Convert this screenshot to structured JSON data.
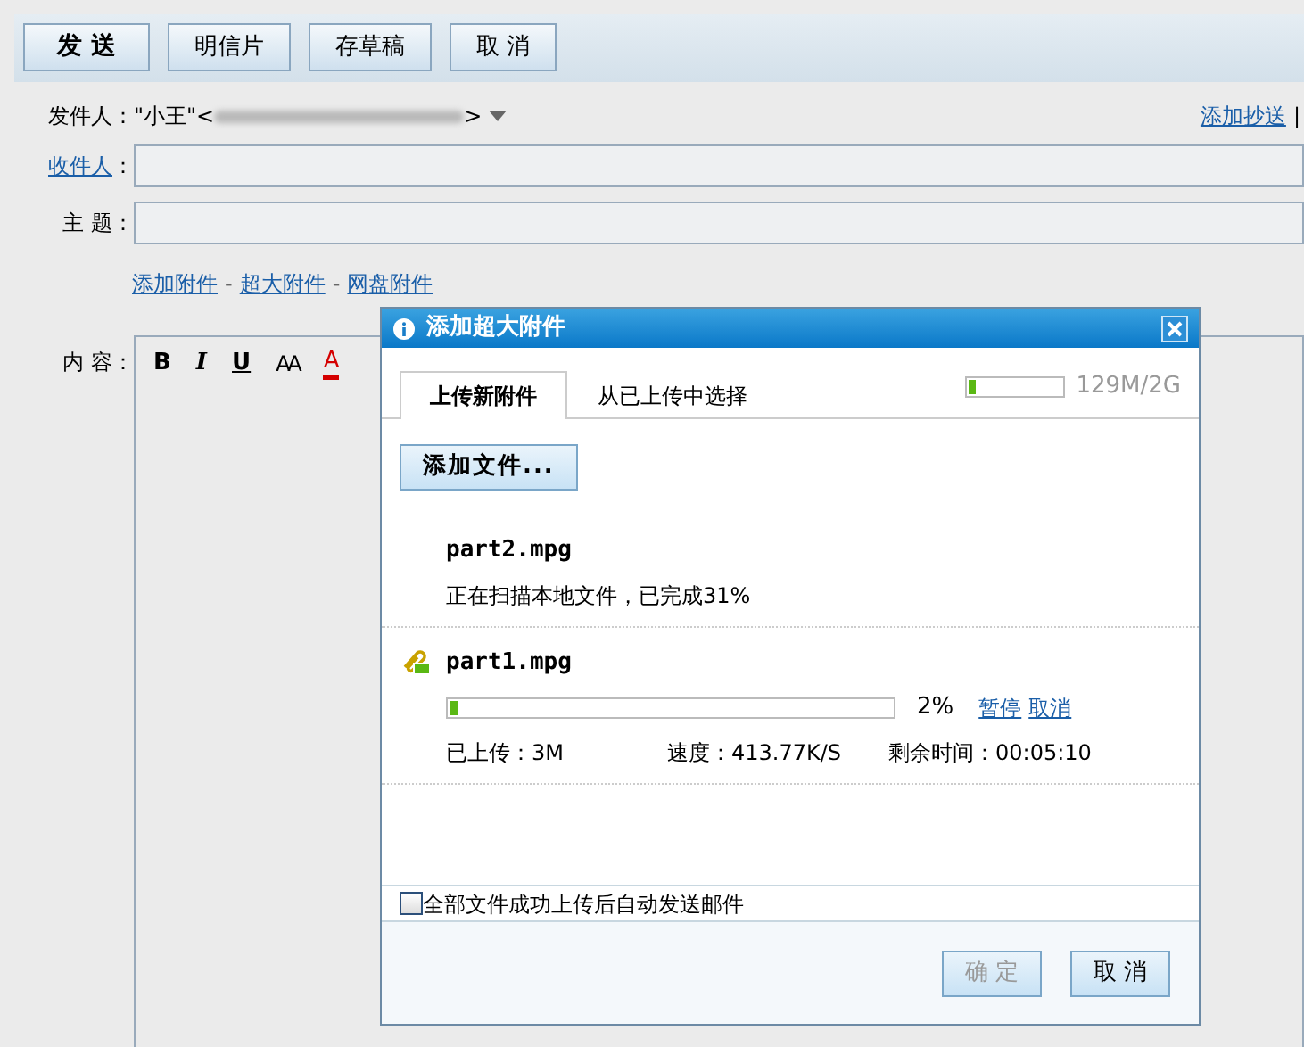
{
  "toolbar": {
    "buttons": [
      {
        "label": "发 送",
        "kind": "primary"
      },
      {
        "label": "明信片",
        "kind": "normal"
      },
      {
        "label": "存草稿",
        "kind": "normal"
      },
      {
        "label": "取 消",
        "kind": "normal"
      }
    ]
  },
  "sender": {
    "label": "发件人：",
    "value_start": "\"小王\"<",
    "value_end": ">"
  },
  "add_cc": "添加抄送",
  "right_separator": "|",
  "recipient": {
    "link": "收件人",
    "colon": "："
  },
  "subject": {
    "label": "主 题："
  },
  "attach_links": [
    {
      "label": "添加附件"
    },
    {
      "label": "超大附件"
    },
    {
      "label": "网盘附件"
    }
  ],
  "attach_separator": "-",
  "content": {
    "label": "内 容："
  },
  "editor_tools": [
    {
      "kind": "bold",
      "label": "B"
    },
    {
      "kind": "italic",
      "label": "I"
    },
    {
      "kind": "underline",
      "label": "U"
    },
    {
      "kind": "size",
      "label": "AA"
    },
    {
      "kind": "color",
      "label": "A",
      "color": "#d40000"
    }
  ],
  "dialog": {
    "title": "添加超大附件",
    "tabs": [
      {
        "label": "上传新附件",
        "selected": true
      },
      {
        "label": "从已上传中选择",
        "selected": false
      }
    ],
    "quota": {
      "level": 0.06,
      "reading": "129M/2G"
    },
    "add_button": "添加文件...",
    "files": [
      {
        "kind": "scanning",
        "name": "part2.mpg",
        "status": "正在扫描本地文件，已完成31%"
      },
      {
        "kind": "uploading",
        "name": "part1.mpg",
        "level": 0.02,
        "percent": "2%",
        "actions": [
          "暂停",
          "取消"
        ],
        "uploaded": "已上传：3M",
        "speed": "速度：413.77K/S",
        "remaining": "剩余时间：00:05:10"
      }
    ],
    "auto_send": {
      "label": "全部文件成功上传后自动发送邮件",
      "checked": false
    },
    "buttons": [
      {
        "label": "确 定",
        "disabled": true
      },
      {
        "label": "取 消",
        "disabled": false
      }
    ]
  }
}
